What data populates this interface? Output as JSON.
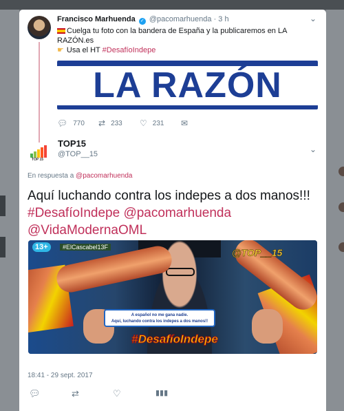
{
  "parent_tweet": {
    "name": "Francisco Marhuenda",
    "verified_mark": "✓",
    "handle": "@pacomarhuenda",
    "separator": "·",
    "time": "3 h",
    "caret": "⌄",
    "line1": "Cuelga tu foto con la bandera de España y la publicaremos en LA RAZÓN.es",
    "line2_prefix": "Usa el HT ",
    "line2_hashtag": "#DesafíoIndepe",
    "banner_text": "LA RAZÓN",
    "actions": {
      "reply_count": "770",
      "retweet_count": "233",
      "like_count": "231"
    }
  },
  "tweet": {
    "name": "TOP15",
    "handle": "@TOP__15",
    "avatar_label": "TOP 15",
    "caret": "⌄",
    "reply_prefix": "En respuesta a ",
    "reply_handle": "@pacomarhuenda",
    "text_plain": "Aquí luchando contra los indepes a dos manos!!! ",
    "text_hashtag": "#DesafíoIndepe",
    "text_mention1": " @pacomarhuenda",
    "text_mention2": "@VidaModernaOML",
    "media": {
      "age_badge": "13+",
      "tv_tag": "#ElCascabel13F",
      "watermark": "@TOP__15",
      "bubble_line1": "A español no me gana nadie.",
      "bubble_line2": "Aquí, luchando contra los indepes a dos manos!!",
      "overlay_hashtag": "#DesafíoIndepe"
    },
    "timestamp": "18:41 - 29 sept. 2017"
  },
  "icons": {
    "reply": "reply-icon",
    "retweet": "retweet-icon",
    "like": "heart-icon",
    "message": "envelope-icon",
    "analytics": "analytics-icon"
  },
  "colors": {
    "hashtag": "#c0305a",
    "thread_line": "#e1a7b3",
    "banner_blue": "#1d3e95",
    "secondary_text": "#657786"
  }
}
